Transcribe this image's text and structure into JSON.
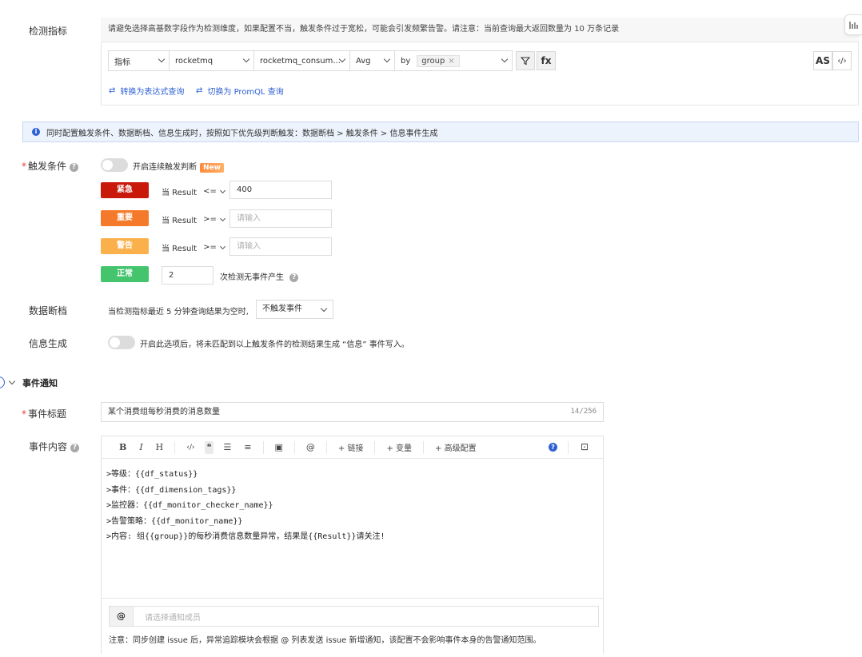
{
  "detect": {
    "label": "检测指标",
    "hint": "请避免选择高基数字段作为检测维度，如果配置不当，触发条件过于宽松，可能会引发频繁告警。请注意：当前查询最大返回数量为 10 万条记录",
    "query": {
      "type": "指标",
      "source": "rocketmq",
      "metric": "rocketmq_consum...",
      "agg": "Avg",
      "by": "by",
      "group_tag": "group",
      "filter_icon": "filter-icon",
      "fx": "fx"
    },
    "as_btn": "AS",
    "code_btn": "‹/›",
    "link_expr": "转换为表达式查询",
    "link_promql": "切换为 PromQL 查询"
  },
  "info_bar": "同时配置触发条件、数据断档、信息生成时，按照如下优先级判断触发：数据断档 > 触发条件 > 信息事件生成",
  "trigger": {
    "label": "触发条件",
    "continuous": "开启连续触发判断",
    "new_badge": "New",
    "levels": [
      {
        "name": "紧急",
        "color": "#c9190b",
        "prefix": "当 Result",
        "op": "<=",
        "value": "400",
        "placeholder": ""
      },
      {
        "name": "重要",
        "color": "#f5792a",
        "prefix": "当 Result",
        "op": ">=",
        "value": "",
        "placeholder": "请输入"
      },
      {
        "name": "警告",
        "color": "#fbb14b",
        "prefix": "当 Result",
        "op": ">=",
        "value": "",
        "placeholder": "请输入"
      }
    ],
    "normal": {
      "name": "正常",
      "color": "#45c46e",
      "value": "2",
      "suffix": "次检测无事件产生"
    }
  },
  "nodata": {
    "label": "数据断档",
    "text": "当检测指标最近 5 分钟查询结果为空时,",
    "select": "不触发事件"
  },
  "infogen": {
    "label": "信息生成",
    "text": "开启此选项后，将未匹配到以上触发条件的检测结果生成 “信息” 事件写入。"
  },
  "section": {
    "title": "事件通知"
  },
  "event_title": {
    "label": "事件标题",
    "value": "某个消费组每秒消费的消息数量",
    "count": "14/256"
  },
  "event_content": {
    "label": "事件内容",
    "toolbar": {
      "bold": "B",
      "italic": "I",
      "heading": "H",
      "code": "‹/›",
      "quote": "❝",
      "ul": "☰",
      "ol": "≡",
      "image": "▣",
      "mention": "@",
      "link": "+ 链接",
      "var": "+ 变量",
      "advanced": "+ 高级配置",
      "help": "?",
      "preview": "⊡"
    },
    "lines": [
      ">等级：{{df_status}}",
      ">事件：{{df_dimension_tags}}",
      ">监控器：{{df_monitor_checker_name}}",
      ">告警策略：{{df_monitor_name}}",
      ">内容:  组{{group}}的每秒消费信息数量异常，结果是{{Result}}请关注!"
    ],
    "at": "@",
    "member_placeholder": "请选择通知成员",
    "member_note": "注意：同步创建 issue 后，异常追踪模块会根据 @ 列表发送 issue 新增通知，该配置不会影响事件本身的告警通知范围。"
  }
}
